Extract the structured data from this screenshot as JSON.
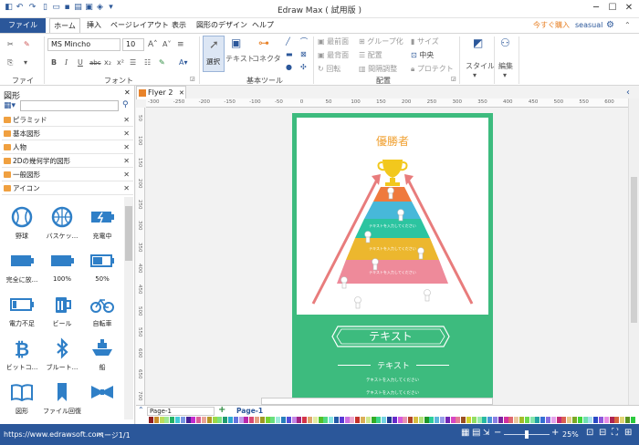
{
  "window": {
    "title": "Edraw Max ( 試用版 )",
    "min": "─",
    "max": "☐",
    "close": "✕"
  },
  "menu": {
    "file": "ファイル",
    "tabs": [
      "ホーム",
      "挿入",
      "ページレイアウト",
      "表示",
      "図形のデザイン",
      "ヘルプ"
    ],
    "buy_now": "今すぐ購入",
    "user": "seasual"
  },
  "ribbon": {
    "font_name": "MS Mincho",
    "font_size": "10",
    "groups": {
      "file": "ファイル",
      "font": "フォント",
      "basic_tools": "基本ツール",
      "arrange": "配置"
    },
    "tools": {
      "select": "選択",
      "text": "テキスト",
      "connector": "コネクタ"
    },
    "arrange": {
      "bring_front": "最前面",
      "send_back": "最背面",
      "rotate": "回転",
      "group": "グループ化",
      "align": "配置",
      "distribute": "間隔調整",
      "size": "サイズ",
      "center": "中央",
      "protect": "プロテクト"
    },
    "style": "スタイル",
    "edit": "編集",
    "format_buttons": [
      "B",
      "I",
      "U",
      "abc",
      "x₂",
      "x²"
    ]
  },
  "left_panel": {
    "title": "図形",
    "libraries": [
      "ピラミッド",
      "基本図形",
      "人物",
      "2Dの幾何学的図形",
      "一般図形",
      "アイコン"
    ],
    "shapes": [
      {
        "label": "野球",
        "icon": "baseball-icon"
      },
      {
        "label": "バスケッ...",
        "icon": "basketball-icon"
      },
      {
        "label": "充電中",
        "icon": "battery-charging-icon"
      },
      {
        "label": "完全に放...",
        "icon": "battery-empty-icon"
      },
      {
        "label": "100%",
        "icon": "battery-full-icon"
      },
      {
        "label": "50%",
        "icon": "battery-half-icon"
      },
      {
        "label": "電力不足",
        "icon": "battery-low-icon"
      },
      {
        "label": "ビール",
        "icon": "beer-icon"
      },
      {
        "label": "自転車",
        "icon": "bicycle-icon"
      },
      {
        "label": "ビットコ...",
        "icon": "bitcoin-icon"
      },
      {
        "label": "ブルート...",
        "icon": "bluetooth-icon"
      },
      {
        "label": "船",
        "icon": "boat-icon"
      },
      {
        "label": "図形",
        "icon": "book-icon"
      },
      {
        "label": "ファイル回復",
        "icon": "bookmark-icon"
      },
      {
        "label": "",
        "icon": "bow-tie-icon"
      }
    ]
  },
  "document": {
    "tab": "Flyer 2",
    "ruler_h": [
      "-300",
      "-250",
      "-200",
      "-150",
      "-100",
      "-50",
      "0",
      "50",
      "100",
      "150",
      "200",
      "250",
      "300",
      "350",
      "400",
      "450",
      "500",
      "550",
      "600"
    ],
    "ruler_v": [
      "50",
      "100",
      "150",
      "200",
      "250",
      "300",
      "350",
      "400",
      "450",
      "500",
      "550",
      "600",
      "650",
      "700"
    ]
  },
  "poster": {
    "winner": "優勝者",
    "pyramid_text": "テキストを入力してください",
    "banner_text": "テキスト",
    "sub_text": "テキスト",
    "body_line1": "テキストを入力してください",
    "body_line2": "テキストを入力してください",
    "colors": {
      "background": "#3dbb7e",
      "layer1": "#ef7a3d",
      "layer2": "#47b8d9",
      "layer3": "#2cc4a0",
      "layer4": "#ecb72e",
      "layer5": "#ee8a9a",
      "trophy": "#f2c81d",
      "arrow": "#e87c7c"
    }
  },
  "pages": {
    "page_select": "Page-1",
    "page_tab": "Page-1"
  },
  "status": {
    "url": "https://www.edrawsoft.com",
    "page": "ページ1/1",
    "zoom": "25%"
  }
}
